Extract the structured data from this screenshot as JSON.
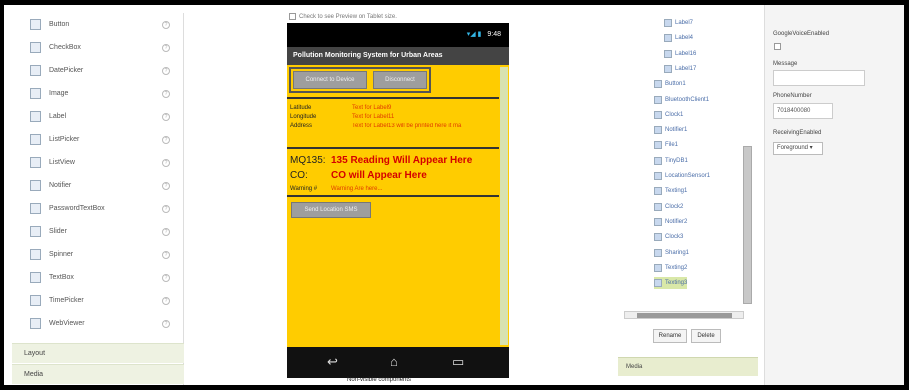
{
  "palette": {
    "items": [
      {
        "label": "Button",
        "icon": "button-icon"
      },
      {
        "label": "CheckBox",
        "icon": "checkbox-icon"
      },
      {
        "label": "DatePicker",
        "icon": "datepicker-icon"
      },
      {
        "label": "Image",
        "icon": "image-icon"
      },
      {
        "label": "Label",
        "icon": "label-icon"
      },
      {
        "label": "ListPicker",
        "icon": "listpicker-icon"
      },
      {
        "label": "ListView",
        "icon": "listview-icon"
      },
      {
        "label": "Notifier",
        "icon": "notifier-icon"
      },
      {
        "label": "PasswordTextBox",
        "icon": "password-icon"
      },
      {
        "label": "Slider",
        "icon": "slider-icon"
      },
      {
        "label": "Spinner",
        "icon": "spinner-icon"
      },
      {
        "label": "TextBox",
        "icon": "textbox-icon"
      },
      {
        "label": "TimePicker",
        "icon": "timepicker-icon"
      },
      {
        "label": "WebViewer",
        "icon": "webviewer-icon"
      }
    ],
    "help_glyph": "?",
    "sections": [
      {
        "label": "Layout"
      },
      {
        "label": "Media"
      }
    ]
  },
  "viewer": {
    "tablet_preview_label": "Check to see Preview on Tablet size.",
    "status_time": "9:48",
    "status_icons": "▾◢ ▮",
    "app_title": "Pollution Monitoring System for Urban Areas",
    "connect_button": "Connect to Device",
    "disconnect_button": "Disconnect",
    "location": {
      "latitude_label": "Latitude",
      "latitude_value": "Text for Label9",
      "longitude_label": "Longitude",
      "longitude_value": "Text for Label11",
      "address_label": "Address",
      "address_value": "Text for Label13 will be printed here it ma"
    },
    "readings": {
      "mq135_label": "MQ135:",
      "mq135_value": "135 Reading Will Appear Here",
      "co_label": "CO:",
      "co_value": "CO will Appear Here",
      "warning_label": "Warning #",
      "warning_value": "Warning Are here..."
    },
    "send_location_button": "Send Location SMS",
    "nav_icons": {
      "back": "↩",
      "home": "⌂",
      "recent": "▭"
    },
    "nonvisible_label": "Non-visible components"
  },
  "components": {
    "items": [
      {
        "label": "Label7",
        "sel": false
      },
      {
        "label": "Label4",
        "sel": false
      },
      {
        "label": "Label16",
        "sel": false
      },
      {
        "label": "Label17",
        "sel": false
      },
      {
        "label": "Button1",
        "sel": false
      },
      {
        "label": "BluetoothClient1",
        "sel": false
      },
      {
        "label": "Clock1",
        "sel": false
      },
      {
        "label": "Notifier1",
        "sel": false
      },
      {
        "label": "File1",
        "sel": false
      },
      {
        "label": "TinyDB1",
        "sel": false
      },
      {
        "label": "LocationSensor1",
        "sel": false
      },
      {
        "label": "Texting1",
        "sel": false
      },
      {
        "label": "Clock2",
        "sel": false
      },
      {
        "label": "Notifier2",
        "sel": false
      },
      {
        "label": "Clock3",
        "sel": false
      },
      {
        "label": "Sharing1",
        "sel": false
      },
      {
        "label": "Texting2",
        "sel": false
      },
      {
        "label": "Texting3",
        "sel": true
      }
    ],
    "rename_button": "Rename",
    "delete_button": "Delete",
    "media_label": "Media"
  },
  "properties": {
    "google_voice_label": "GoogleVoiceEnabled",
    "message_label": "Message",
    "message_value": "",
    "phone_label": "PhoneNumber",
    "phone_value": "7018400080",
    "receiving_label": "ReceivingEnabled",
    "receiving_value": "Foreground ▾"
  },
  "colors": {
    "screen_bg": "#ffcc00",
    "selected": "#d9e8a8",
    "red_text": "#d40000"
  }
}
